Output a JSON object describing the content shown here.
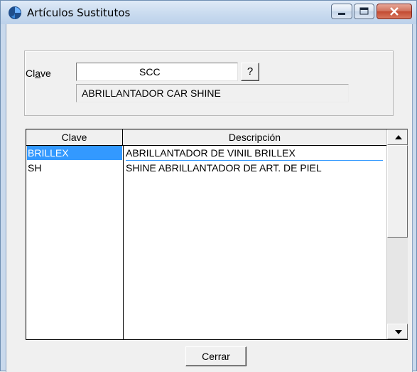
{
  "window": {
    "title": "Artículos Sustitutos",
    "icon": "blue-swirl-icon"
  },
  "form": {
    "clave_label_prefix": "Cl",
    "clave_label_accel": "a",
    "clave_label_suffix": "ve",
    "clave_value": "SCC",
    "help_button_label": "?",
    "description_value": "ABRILLANTADOR CAR SHINE"
  },
  "grid": {
    "columns": [
      "Clave",
      "Descripción"
    ],
    "rows": [
      {
        "clave": "BRILLEX",
        "descripcion": "ABRILLANTADOR DE VINIL BRILLEX",
        "selected": true
      },
      {
        "clave": "SH",
        "descripcion": "SHINE ABRILLANTADOR DE ART. DE PIEL",
        "selected": false
      }
    ]
  },
  "footer": {
    "close_button_label": "Cerrar"
  },
  "colors": {
    "selection": "#3399ff",
    "title_bar": "#c9dbef",
    "close_button": "#c24a32"
  }
}
